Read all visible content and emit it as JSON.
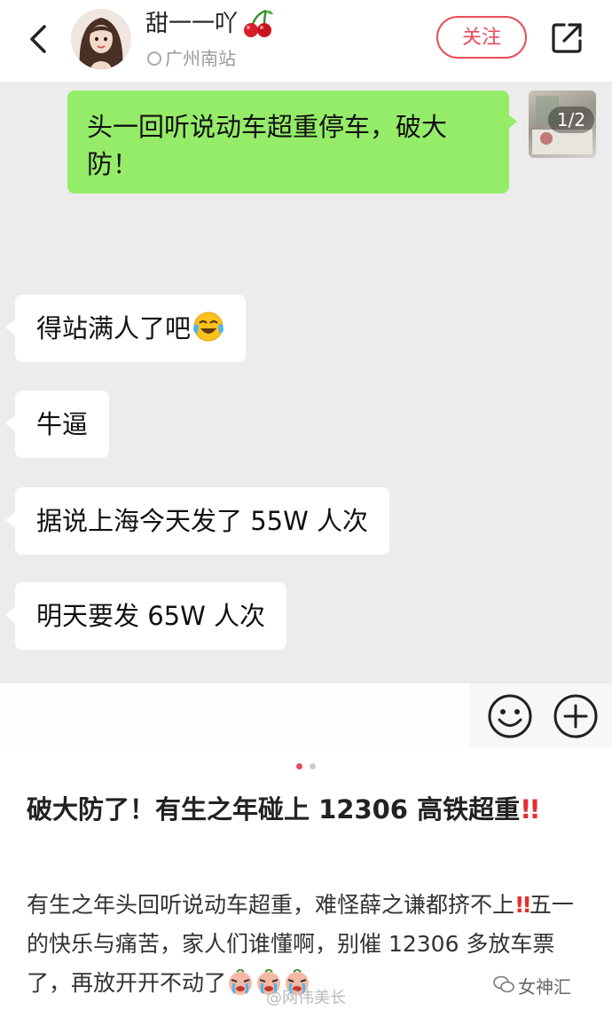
{
  "header": {
    "author_name": "甜一一吖",
    "location": "广州南站",
    "follow_label": "关注"
  },
  "chat": {
    "sent_text": "头一回听说动车超重停车，破大防！",
    "image_counter": "1/2",
    "messages": [
      {
        "text": "得站满人了吧"
      },
      {
        "text": "牛逼"
      },
      {
        "text": "据说上海今天发了 55W 人次"
      },
      {
        "text": "明天要发 65W 人次"
      }
    ]
  },
  "pager": {
    "current": 1,
    "total": 2
  },
  "post": {
    "title": "破大防了！有生之年碰上 12306 高铁超重",
    "body_part1": "有生之年头回听说动车超重，难怪薛之谦都挤不上",
    "body_part2": "五一的快乐与痛苦，家人们谁懂啊，别催 12306 多放车票了，再放开开不动了"
  },
  "watermarks": {
    "weibo": "@网伟美长",
    "account": "女神汇"
  },
  "colors": {
    "accent": "#e94c5a",
    "sent_bubble": "#95ec69",
    "chat_bg": "#ececec"
  },
  "icons": [
    "back-icon",
    "cherry-icon",
    "location-icon",
    "share-icon",
    "smile-icon",
    "plus-icon",
    "tears-of-joy-emoji",
    "crying-face-emoji",
    "double-exclamation-icon",
    "wechat-logo-icon"
  ]
}
